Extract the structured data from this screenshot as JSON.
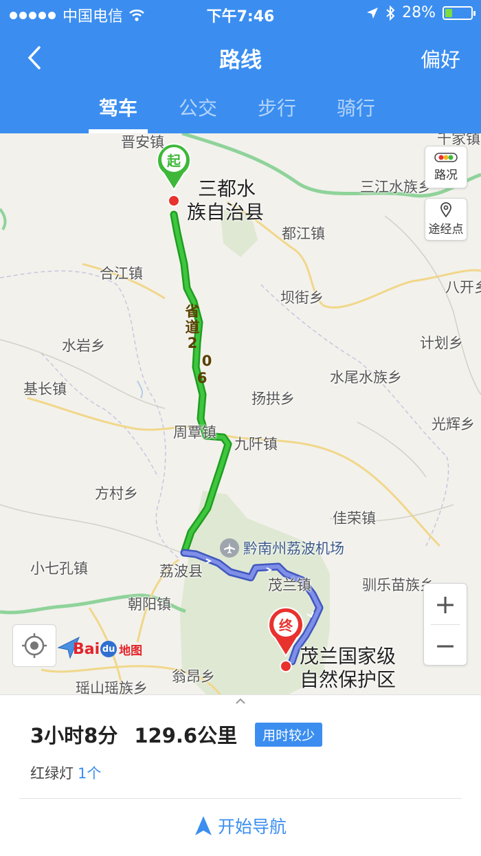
{
  "status_bar": {
    "carrier": "中国电信",
    "time": "下午7:46",
    "battery_text": "28%",
    "battery_level": 0.28
  },
  "nav": {
    "title": "路线",
    "preference": "偏好"
  },
  "tabs": [
    {
      "label": "驾车",
      "active": true
    },
    {
      "label": "公交",
      "active": false
    },
    {
      "label": "步行",
      "active": false
    },
    {
      "label": "骑行",
      "active": false
    }
  ],
  "map": {
    "traffic_label": "路况",
    "waypoint_label": "途经点",
    "zoom_in": "+",
    "zoom_out": "−",
    "start_marker": "起",
    "end_marker": "终",
    "road_label_chars": [
      "省",
      "道",
      "2",
      "0",
      "6"
    ],
    "airport_name": "黔南州荔波机场",
    "origin_name_line1": "三都水",
    "origin_name_line2": "族自治县",
    "destination_name_line1": "茂兰国家级",
    "destination_name_line2": "自然保护区",
    "places": [
      "晋安镇",
      "千家镇",
      "三江水族乡",
      "都江镇",
      "合江镇",
      "八开乡",
      "坝街乡",
      "水岩乡",
      "计划乡",
      "水尾水族乡",
      "基长镇",
      "扬拱乡",
      "光辉乡",
      "周覃镇",
      "九阡镇",
      "方村乡",
      "佳荣镇",
      "小七孔镇",
      "荔波县",
      "茂兰镇",
      "驯乐苗族乡",
      "朝阳镇",
      "翁昂乡",
      "瑶山瑶族乡"
    ],
    "logo": {
      "text": "Bai",
      "paw": "du",
      "map": "地图"
    }
  },
  "route": {
    "duration": "3小时8分",
    "distance": "129.6公里",
    "badge": "用时较少",
    "traffic_lights_label": "红绿灯",
    "traffic_lights_count": "1个",
    "start_navigation": "开始导航"
  }
}
